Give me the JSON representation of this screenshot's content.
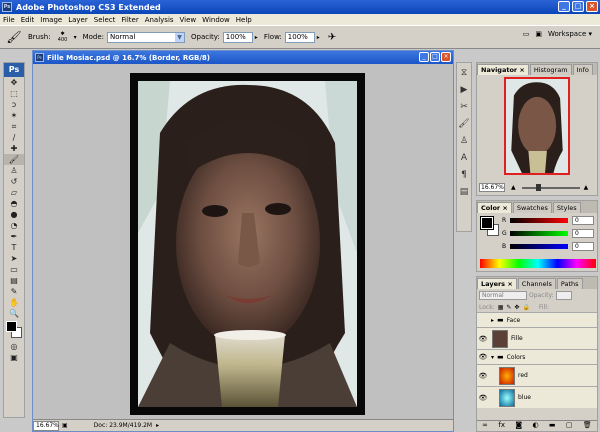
{
  "titlebar": {
    "title": "Adobe Photoshop CS3 Extended",
    "logo": "Ps"
  },
  "menubar": {
    "items": [
      "File",
      "Edit",
      "Image",
      "Layer",
      "Select",
      "Filter",
      "Analysis",
      "View",
      "Window",
      "Help"
    ]
  },
  "options": {
    "brush_label": "Brush:",
    "brush_size": "400",
    "mode_label": "Mode:",
    "mode_value": "Normal",
    "opacity_label": "Opacity:",
    "opacity_value": "100%",
    "flow_label": "Flow:",
    "flow_value": "100%",
    "workspace_label": "Workspace"
  },
  "tools": {
    "logo": "Ps"
  },
  "document": {
    "title": "Fille Mosiac.psd @ 16.7% (Border, RGB/8)",
    "zoom": "16.67%",
    "doc_info": "Doc: 23.9M/419.2M"
  },
  "navigator": {
    "tabs": [
      "Navigator",
      "Histogram",
      "Info"
    ],
    "zoom": "16.67%"
  },
  "color_panel": {
    "tabs": [
      "Color",
      "Swatches",
      "Styles"
    ],
    "channels": [
      {
        "label": "R",
        "value": "0"
      },
      {
        "label": "G",
        "value": "0"
      },
      {
        "label": "B",
        "value": "0"
      }
    ]
  },
  "layers": {
    "tabs": [
      "Layers",
      "Channels",
      "Paths"
    ],
    "blend_mode": "Normal",
    "opacity_label": "Opacity:",
    "lock_label": "Lock:",
    "fill_label": "Fill:",
    "items": [
      {
        "name": "Face",
        "type": "group"
      },
      {
        "name": "Fille",
        "type": "layer"
      },
      {
        "name": "Colors",
        "type": "group"
      },
      {
        "name": "red",
        "type": "layer"
      },
      {
        "name": "blue",
        "type": "layer"
      }
    ]
  },
  "colors": {
    "accent": "#0b46b8",
    "panel": "#d4d0c8"
  }
}
